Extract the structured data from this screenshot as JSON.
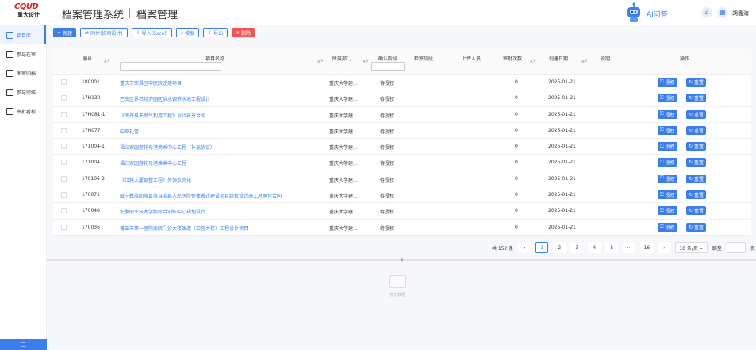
{
  "header": {
    "logo_mark": "CQUD",
    "logo_name": "重大设计",
    "system_title": "档案管理系统",
    "page_title": "档案管理",
    "ai_label": "AI问答",
    "user_name": "胡鑫海"
  },
  "sidebar": {
    "items": [
      {
        "label": "项目库"
      },
      {
        "label": "参与在审"
      },
      {
        "label": "图审归档"
      },
      {
        "label": "参与完结"
      },
      {
        "label": "审批看板"
      }
    ],
    "bottom_label": "三"
  },
  "toolbar": {
    "new": "新建",
    "sync": "同步(协同设计)",
    "import": "导入(Excel)",
    "template": "模板",
    "export": "导出",
    "delete": "删除"
  },
  "table": {
    "columns": [
      "编号",
      "项目名称",
      "所属部门",
      "确认阶段",
      "检审阶段",
      "上传人员",
      "审批次数",
      "创建日期",
      "说明",
      "操作"
    ],
    "action_auth": "授权",
    "action_reset": "重置",
    "rows": [
      {
        "id": "180001",
        "name": "重庆市荣昌区中医院迁建项目",
        "dept": "重庆大学建...",
        "stage": "待授权",
        "count": "0",
        "date": "2025-01-21",
        "reset": "重置"
      },
      {
        "id": "17H130",
        "name": "巴南区界石经济园区供水调节水池工程设计",
        "dept": "重庆大学建...",
        "stage": "待授权",
        "count": "0",
        "date": "2025-01-21",
        "reset": "重置"
      },
      {
        "id": "17H081-1",
        "name": "《南丹县天然气利用工程》设计补充合同",
        "dept": "重庆大学建...",
        "stage": "待授权",
        "count": "0",
        "date": "2025-01-21",
        "reset": "重置"
      },
      {
        "id": "17H077",
        "name": "中央礼堂",
        "dept": "重庆大学建...",
        "stage": "待授权",
        "count": "0",
        "date": "2025-01-21",
        "reset": "重置"
      },
      {
        "id": "171004-1",
        "name": "福归家园游轮母港换乘中心工程（补充协议）",
        "dept": "重庆大学建...",
        "stage": "待授权",
        "count": "0",
        "date": "2025-01-21",
        "reset": "重置"
      },
      {
        "id": "171004",
        "name": "福归家园游轮母港换乘中心工程",
        "dept": "重庆大学建...",
        "stage": "待授权",
        "count": "0",
        "date": "2025-01-21",
        "reset": "重置"
      },
      {
        "id": "170106-2",
        "name": "《红旗大厦调整工程》外饰及亮化",
        "dept": "重庆大学建...",
        "stage": "待授权",
        "count": "0",
        "date": "2025-01-21",
        "reset": "重置"
      },
      {
        "id": "170071",
        "name": "威宁彝族回族苗族自治县人民医院整体搬迁建设项目蔬板设计施工总承包合同",
        "dept": "重庆大学建...",
        "stage": "待授权",
        "count": "0",
        "date": "2025-01-21",
        "reset": "重置"
      },
      {
        "id": "170048",
        "name": "安徽职业技术学院综合训练中心规划设计",
        "dept": "重庆大学建...",
        "stage": "待授权",
        "count": "0",
        "date": "2025-01-21",
        "reset": "重置"
      },
      {
        "id": "170036",
        "name": "莆田市第一医院南院门诊大楼改造（口腔大楼）工程设计项目",
        "dept": "重庆大学建...",
        "stage": "待授权",
        "count": "0",
        "date": "2025-01-21",
        "reset": "重置"
      }
    ]
  },
  "pagination": {
    "total": "共 152 条",
    "pages": [
      "1",
      "2",
      "3",
      "4",
      "5",
      "···",
      "16"
    ],
    "current": "1",
    "page_size": "10 条/页",
    "goto_label": "跳至",
    "goto_suffix": "页"
  },
  "empty": {
    "text": "暂无数据"
  },
  "colors": {
    "primary": "#3b7de9",
    "danger": "#f25555",
    "logo": "#d62a2a"
  }
}
